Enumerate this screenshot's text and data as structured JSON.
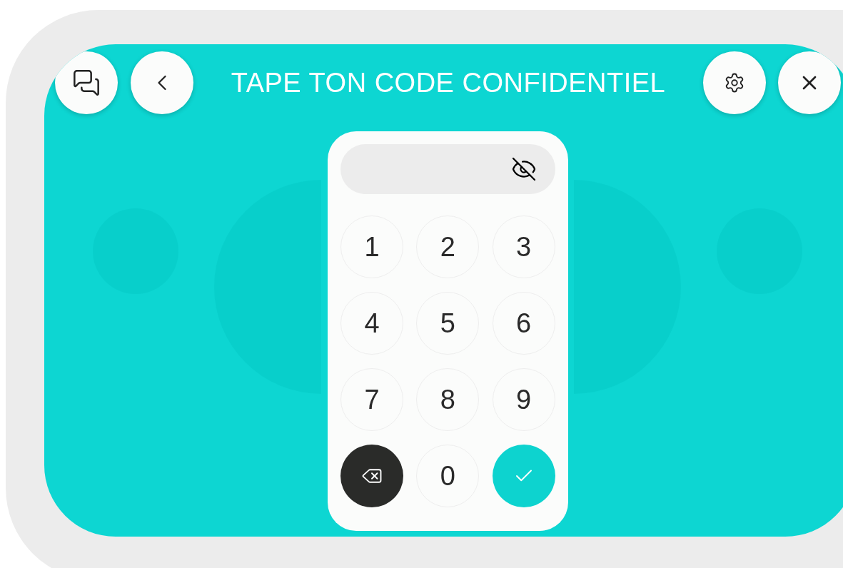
{
  "header": {
    "title": "TAPE TON CODE CONFIDENTIEL"
  },
  "code_field": {
    "masked": true
  },
  "keys": [
    {
      "kind": "digit",
      "label": "1"
    },
    {
      "kind": "digit",
      "label": "2"
    },
    {
      "kind": "digit",
      "label": "3"
    },
    {
      "kind": "digit",
      "label": "4"
    },
    {
      "kind": "digit",
      "label": "5"
    },
    {
      "kind": "digit",
      "label": "6"
    },
    {
      "kind": "digit",
      "label": "7"
    },
    {
      "kind": "digit",
      "label": "8"
    },
    {
      "kind": "digit",
      "label": "9"
    },
    {
      "kind": "delete"
    },
    {
      "kind": "digit",
      "label": "0"
    },
    {
      "kind": "confirm"
    }
  ]
}
